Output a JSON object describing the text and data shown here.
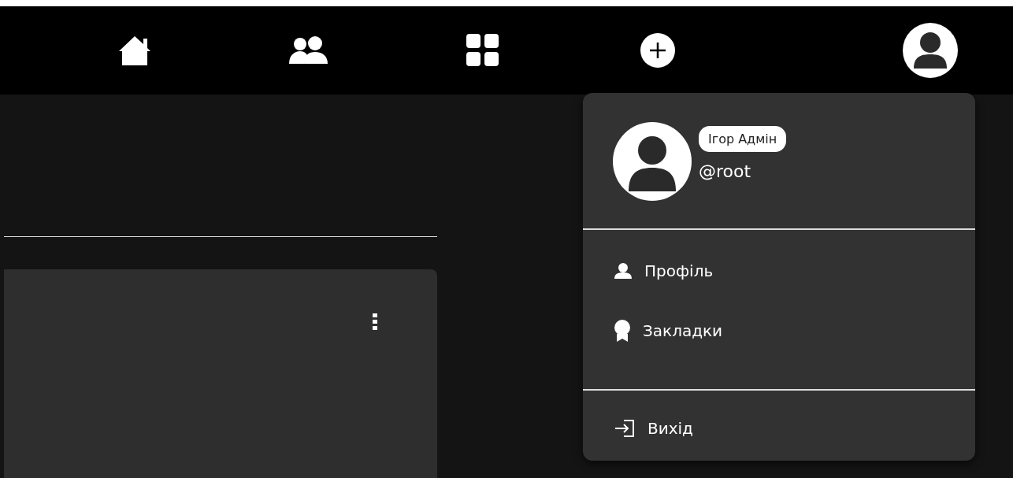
{
  "nav": [
    {
      "kind": "home"
    },
    {
      "kind": "people"
    },
    {
      "kind": "apps"
    },
    {
      "kind": "add"
    },
    {
      "kind": "avatar"
    }
  ],
  "account_menu": {
    "name": "Ігор Адмін",
    "handle": "@root",
    "groups": [
      {
        "items": [
          {
            "kind": "profile",
            "label": "Профіль"
          },
          {
            "kind": "bookmarks",
            "label": "Закладки"
          }
        ]
      },
      {
        "items": [
          {
            "kind": "logout",
            "label": "Вихід"
          }
        ]
      }
    ]
  }
}
